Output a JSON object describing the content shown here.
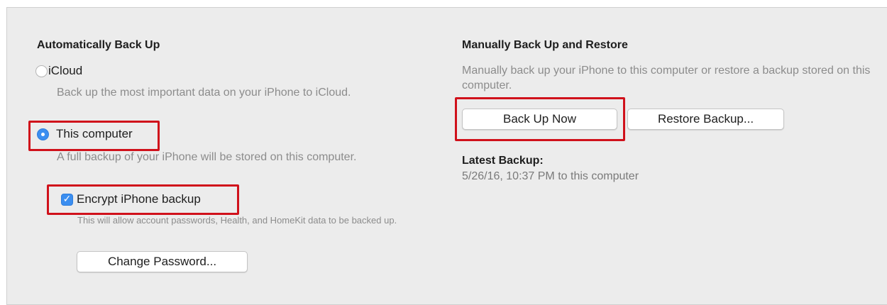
{
  "auto_backup": {
    "heading": "Automatically Back Up",
    "icloud": {
      "label": "iCloud",
      "selected": false,
      "description": "Back up the most important data on your iPhone to iCloud."
    },
    "this_computer": {
      "label": "This computer",
      "selected": true,
      "description": "A full backup of your iPhone will be stored on this computer."
    },
    "encrypt": {
      "label": "Encrypt iPhone backup",
      "checked": true,
      "check_glyph": "✓",
      "description": "This will allow account passwords, Health, and HomeKit data to be backed up."
    },
    "change_password_label": "Change Password..."
  },
  "manual_backup": {
    "heading": "Manually Back Up and Restore",
    "description": "Manually back up your iPhone to this computer or restore a backup stored on this computer.",
    "back_up_now_label": "Back Up Now",
    "restore_backup_label": "Restore Backup..."
  },
  "latest_backup": {
    "heading": "Latest Backup:",
    "value": "5/26/16, 10:37 PM to this computer"
  },
  "colors": {
    "accent": "#3b8ef0",
    "highlight": "#d0111b",
    "panel_background": "#ececec"
  }
}
